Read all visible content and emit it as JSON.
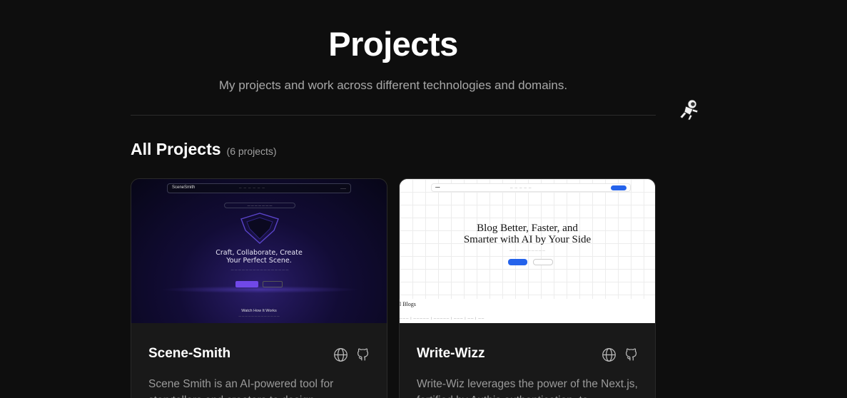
{
  "header": {
    "title": "Projects",
    "subtitle": "My projects and work across different technologies and domains."
  },
  "section": {
    "heading": "All Projects",
    "count": "(6 projects)"
  },
  "projects": [
    {
      "title": "Scene-Smith",
      "description": "Scene Smith is an AI-powered tool for storytellers and creators to design",
      "thumbnail": {
        "logo": "SceneSmith",
        "headline_1": "Craft, Collaborate, Create",
        "headline_2": "Your Perfect Scene.",
        "section": "Watch How It Works"
      }
    },
    {
      "title": "Write-Wizz",
      "description": "Write-Wiz leverages the power of the Next.js, fortified by Authjs authentication, to",
      "thumbnail": {
        "headline_1": "Blog Better, Faster, and",
        "headline_2": "Smarter with AI by Your Side",
        "blogs": "l Blogs"
      }
    }
  ],
  "icons": {
    "website": "globe-icon",
    "source": "github-icon",
    "mascot": "astronaut-mascot-icon"
  },
  "colors": {
    "background": "#0e0e0e",
    "card": "#191919",
    "accent_purple": "#7048e8",
    "accent_blue": "#2563eb"
  }
}
